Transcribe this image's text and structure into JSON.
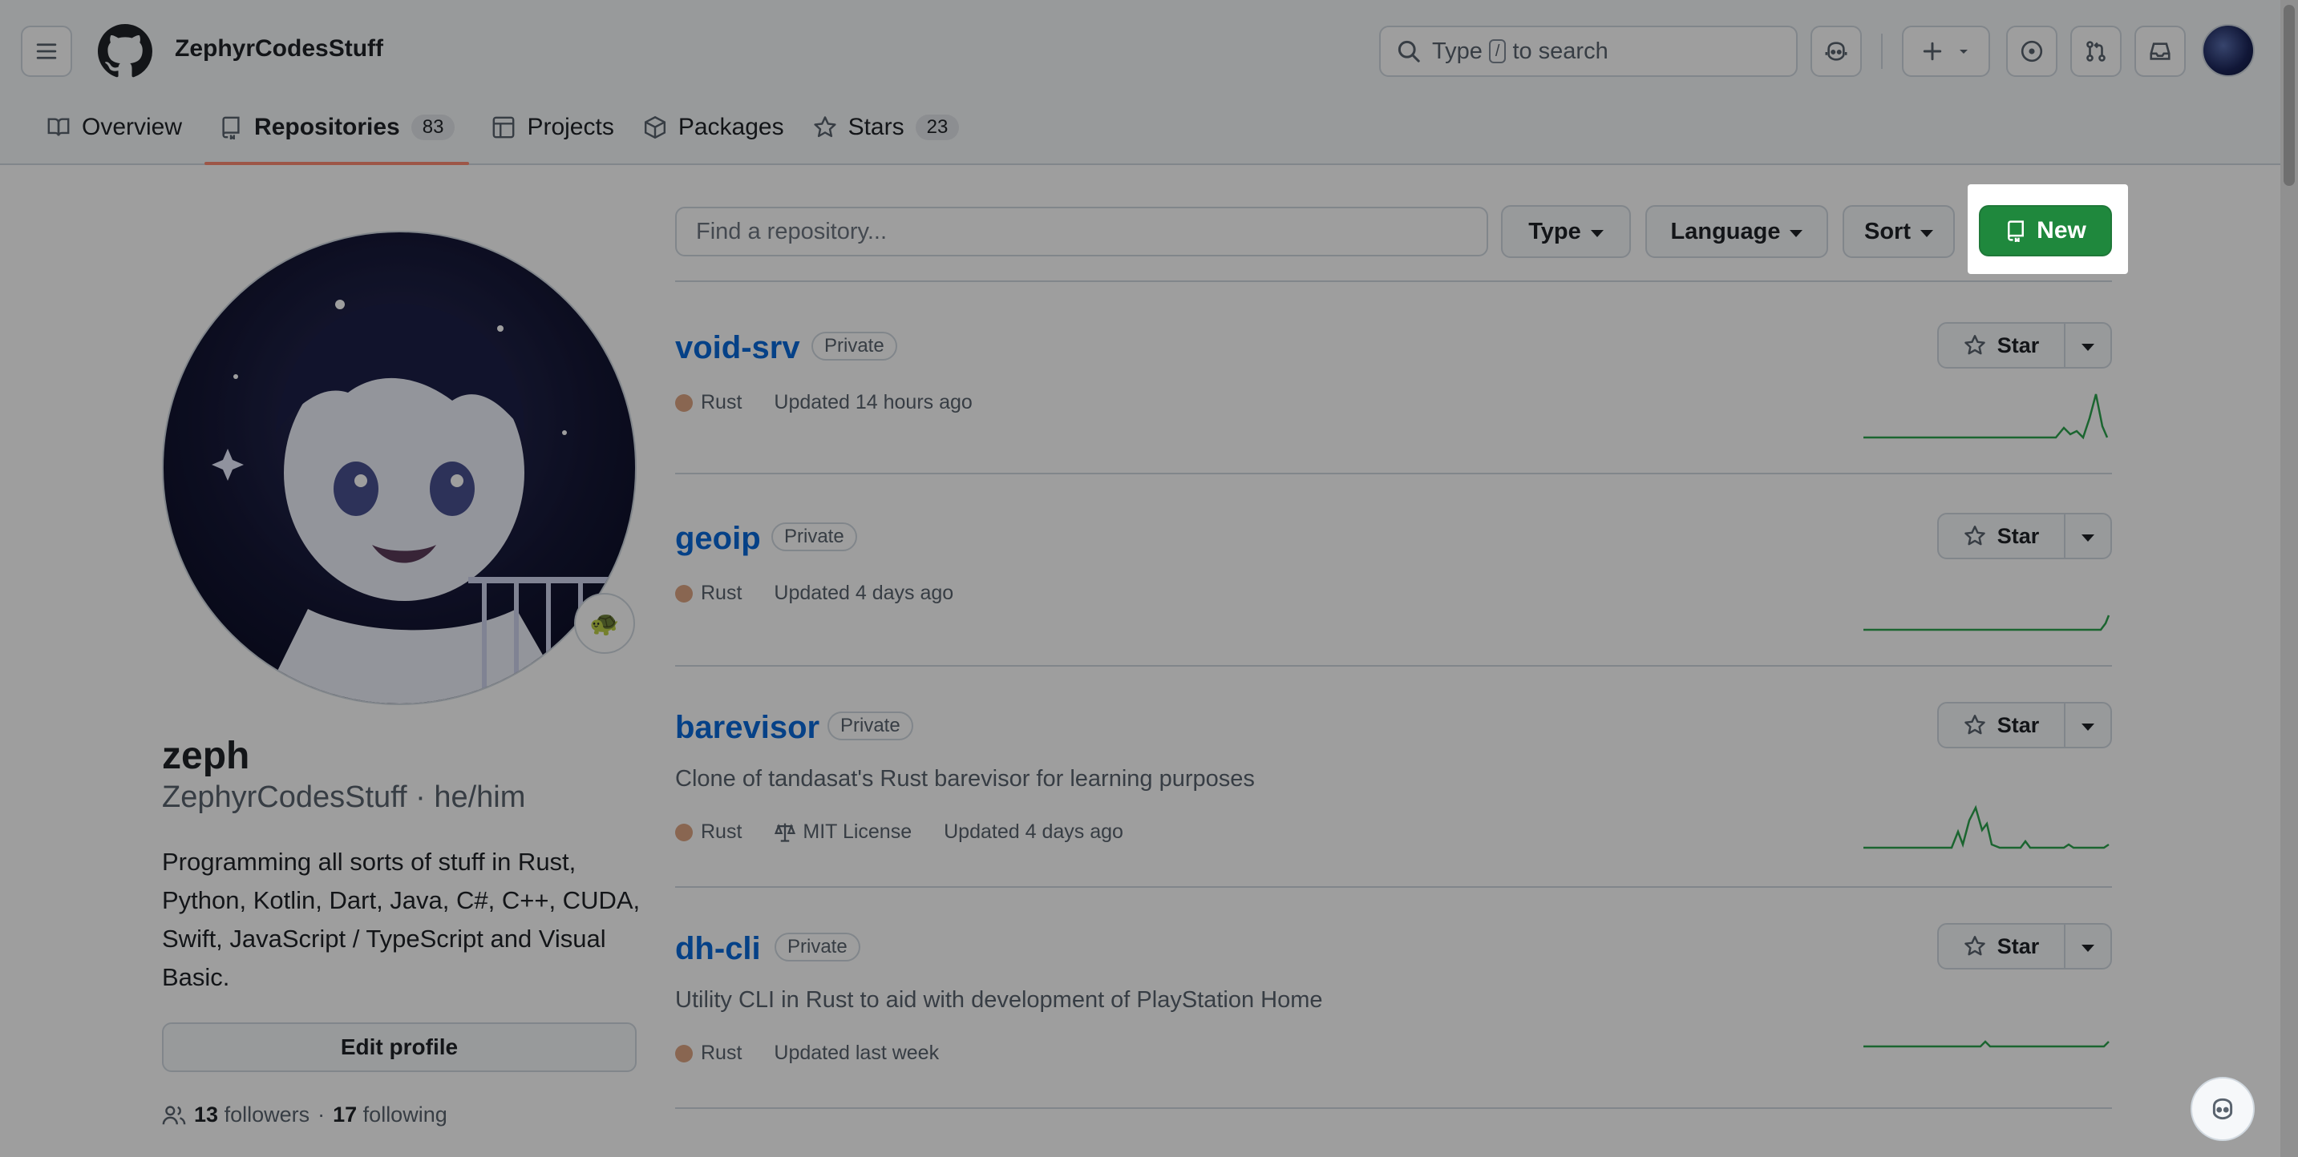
{
  "header": {
    "username": "ZephyrCodesStuff",
    "search": {
      "prefix": "Type",
      "key": "/",
      "suffix": "to search"
    }
  },
  "tabs": [
    {
      "label": "Overview",
      "icon": "book-icon"
    },
    {
      "label": "Repositories",
      "count": "83",
      "icon": "repo-icon",
      "active": true
    },
    {
      "label": "Projects",
      "icon": "table-icon"
    },
    {
      "label": "Packages",
      "icon": "package-icon"
    },
    {
      "label": "Stars",
      "count": "23",
      "icon": "star-icon"
    }
  ],
  "profile": {
    "display_name": "zeph",
    "login_line": "ZephyrCodesStuff · he/him",
    "bio": "Programming all sorts of stuff in Rust, Python, Kotlin, Dart, Java, C#, C++, CUDA, Swift, JavaScript / TypeScript and Visual Basic.",
    "edit_button": "Edit profile",
    "followers_count": "13",
    "followers_label": "followers",
    "separator": "·",
    "following_count": "17",
    "following_label": "following",
    "status_emoji": "🐢"
  },
  "toolbar": {
    "search_placeholder": "Find a repository...",
    "type_label": "Type",
    "language_label": "Language",
    "sort_label": "Sort",
    "new_label": "New"
  },
  "repos": [
    {
      "name": "void-srv",
      "visibility": "Private",
      "description": "",
      "language": "Rust",
      "license": "",
      "updated": "Updated 14 hours ago",
      "star_label": "Star"
    },
    {
      "name": "geoip",
      "visibility": "Private",
      "description": "",
      "language": "Rust",
      "license": "",
      "updated": "Updated 4 days ago",
      "star_label": "Star"
    },
    {
      "name": "barevisor",
      "visibility": "Private",
      "description": "Clone of tandasat's Rust barevisor for learning purposes",
      "language": "Rust",
      "license": "MIT License",
      "updated": "Updated 4 days ago",
      "star_label": "Star"
    },
    {
      "name": "dh-cli",
      "visibility": "Private",
      "description": "Utility CLI in Rust to aid with development of PlayStation Home",
      "language": "Rust",
      "license": "",
      "updated": "Updated last week",
      "star_label": "Star"
    }
  ],
  "colors": {
    "accent_green": "#1f883d",
    "link_blue": "#0969da",
    "rust_dot": "#dea584",
    "tab_underline": "#fd8c73"
  }
}
